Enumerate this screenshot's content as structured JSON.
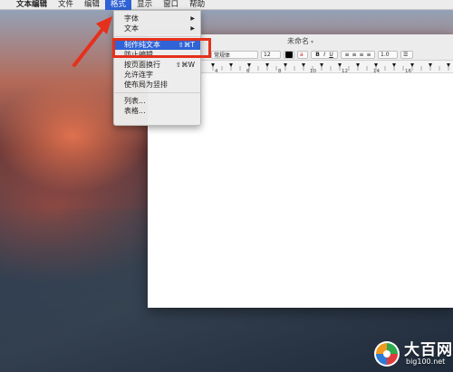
{
  "menubar": {
    "apple_icon": "",
    "app_name": "文本编辑",
    "items": [
      "文件",
      "编辑",
      "格式",
      "显示",
      "窗口",
      "帮助"
    ],
    "active_item": "格式"
  },
  "format_menu": {
    "items": [
      {
        "label": "字体",
        "submenu": true
      },
      {
        "label": "文本",
        "submenu": true
      },
      {
        "separator": true
      },
      {
        "label": "制作纯文本",
        "shortcut": "⇧⌘T",
        "highlighted": true
      },
      {
        "label": "防止编辑"
      },
      {
        "label": "按页面换行",
        "shortcut": "⇧⌘W"
      },
      {
        "label": "允许连字"
      },
      {
        "label": "使布局为竖排"
      },
      {
        "separator": true
      },
      {
        "label": "列表..."
      },
      {
        "label": "表格..."
      }
    ]
  },
  "window": {
    "title": "未命名",
    "toolbar": {
      "style_value": "常规体",
      "font_size": "12",
      "bold_label": "B",
      "italic_label": "I",
      "underline_label": "U",
      "line_spacing": "1.0"
    },
    "ruler_labels": [
      "4",
      "6",
      "8",
      "10",
      "12",
      "14",
      "16"
    ]
  },
  "annotation": {
    "highlight_color": "#e5301c"
  },
  "watermark": {
    "title": "大百网",
    "url": "big100.net"
  },
  "colors": {
    "menu_highlight": "#2f63d6",
    "menubar_bg": "#ececec"
  }
}
